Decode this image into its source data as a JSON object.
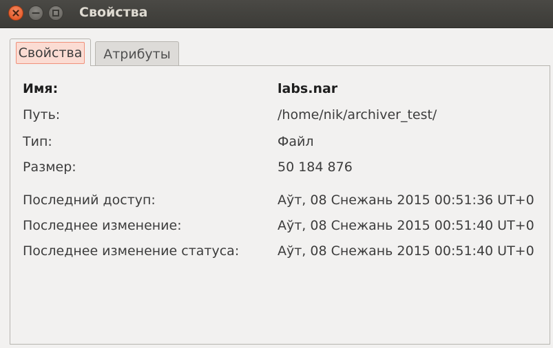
{
  "window": {
    "title": "Свойства"
  },
  "tabs": [
    {
      "label": "Свойства",
      "active": true
    },
    {
      "label": "Атрибуты",
      "active": false
    }
  ],
  "properties": [
    {
      "label": "Имя:",
      "value": "labs.nar"
    },
    {
      "label": "Путь:",
      "value": "/home/nik/archiver_test/"
    },
    {
      "label": "Тип:",
      "value": "Файл"
    },
    {
      "label": "Размер:",
      "value": "50 184 876"
    },
    {
      "label": "Последний доступ:",
      "value": "Аўт, 08 Снежань 2015 00:51:36 UT+0"
    },
    {
      "label": "Последнее изменение:",
      "value": "Аўт, 08 Снежань 2015 00:51:40 UT+0"
    },
    {
      "label": "Последнее изменение статуса:",
      "value": "Аўт, 08 Снежань 2015 00:51:40 UT+0"
    }
  ],
  "colors": {
    "titlebar": "#3c3b37",
    "close_button": "#df4a16",
    "active_tab_highlight": "#fbdcd3"
  }
}
